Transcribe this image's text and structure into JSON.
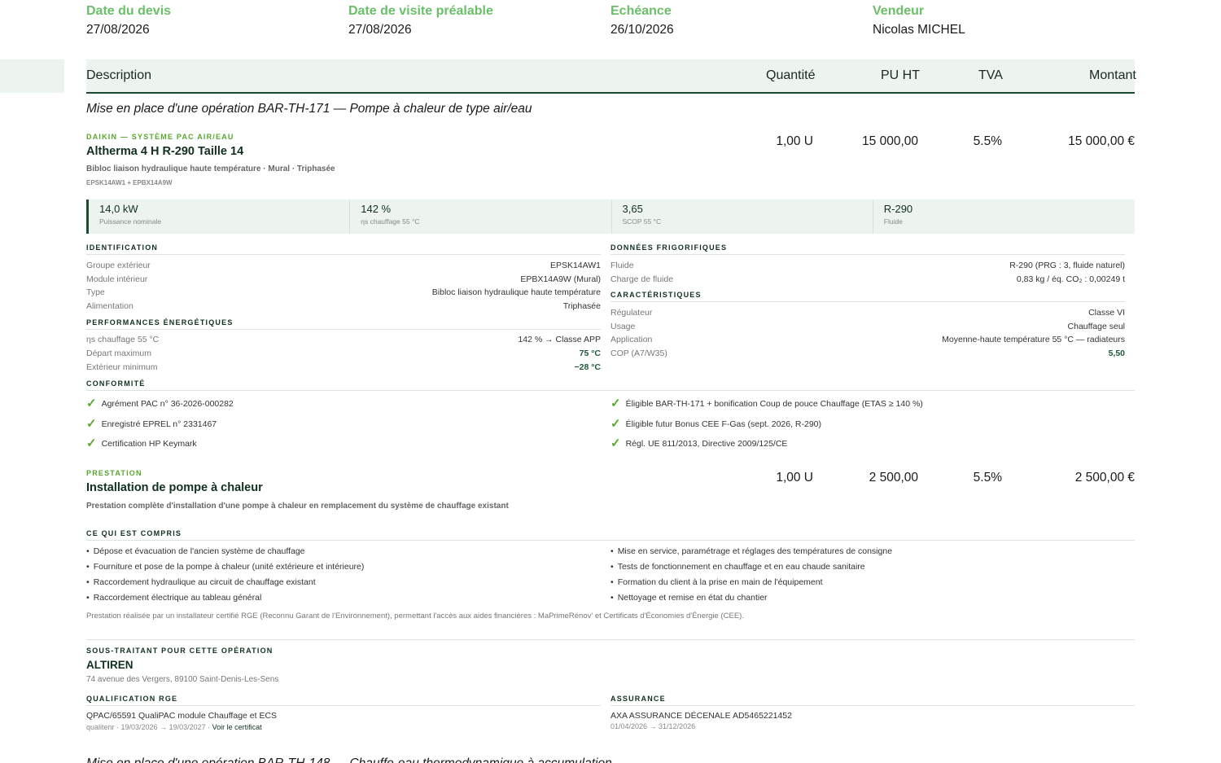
{
  "meta": [
    {
      "label": "Date du devis",
      "value": "27/08/2026"
    },
    {
      "label": "Date de visite préalable",
      "value": "27/08/2026"
    },
    {
      "label": "Echéance",
      "value": "26/10/2026"
    },
    {
      "label": "Vendeur",
      "value": "Nicolas MICHEL"
    }
  ],
  "table_header": {
    "description": "Description",
    "quantity": "Quantité",
    "pu_ht": "PU HT",
    "tva": "TVA",
    "montant": "Montant"
  },
  "section_title": "Mise en place d'une opération BAR-TH-171 — Pompe à chaleur de type air/eau",
  "product": {
    "brand_tag": "DAIKIN — SYSTÈME PAC AIR/EAU",
    "title": "Altherma 4 H R-290 Taille 14",
    "subtitle": "Bibloc liaison hydraulique haute température · Mural · Triphasée",
    "ref": "EPSK14AW1 + EPBX14A9W",
    "quantity": "1,00 U",
    "pu_ht": "15 000,00",
    "tva": "5.5%",
    "montant": "15 000,00 €",
    "specs": [
      {
        "value": "14,0 kW",
        "label": "Puissance nominale"
      },
      {
        "value": "142 %",
        "label": "ηs chauffage 55 °C"
      },
      {
        "value": "3,65",
        "label": "SCOP 55 °C"
      },
      {
        "value": "R-290",
        "label": "Fluide"
      }
    ],
    "identification": {
      "heading": "IDENTIFICATION",
      "rows": [
        {
          "k": "Groupe extérieur",
          "v": "EPSK14AW1"
        },
        {
          "k": "Module intérieur",
          "v": "EPBX14A9W (Mural)"
        },
        {
          "k": "Type",
          "v": "Bibloc liaison hydraulique haute température"
        },
        {
          "k": "Alimentation",
          "v": "Triphasée"
        }
      ]
    },
    "performances": {
      "heading": "PERFORMANCES ÉNERGÉTIQUES",
      "rows": [
        {
          "k": "ηs chauffage 55 °C",
          "v": "142 % → Classe APP"
        },
        {
          "k": "Départ maximum",
          "v": "75 °C"
        },
        {
          "k": "Extérieur minimum",
          "v": "−28 °C"
        }
      ]
    },
    "frigorifiques": {
      "heading": "DONNÉES FRIGORIFIQUES",
      "rows": [
        {
          "k": "Fluide",
          "v": "R-290 (PRG : 3, fluide naturel)"
        },
        {
          "k": "Charge de fluide",
          "v": "0,83 kg / éq. CO₂ : 0,00249 t"
        }
      ]
    },
    "caracteristiques": {
      "heading": "CARACTÉRISTIQUES",
      "rows": [
        {
          "k": "Régulateur",
          "v": "Classe VI"
        },
        {
          "k": "Usage",
          "v": "Chauffage seul"
        },
        {
          "k": "Application",
          "v": "Moyenne-haute température 55 °C — radiateurs"
        },
        {
          "k": "COP (A7/W35)",
          "v": "5,50"
        }
      ]
    },
    "conformite": {
      "heading": "CONFORMITÉ",
      "left": [
        "Agrément PAC n° 36-2026-000282",
        "Enregistré EPREL n° 2331467",
        "Certification HP Keymark"
      ],
      "right": [
        "Éligible BAR-TH-171 + bonification Coup de pouce Chauffage (ETAS ≥ 140 %)",
        "Éligible futur Bonus CEE F-Gas (sept. 2026, R-290)",
        "Régl. UE 811/2013, Directive 2009/125/CE"
      ]
    }
  },
  "prestation": {
    "tag": "PRESTATION",
    "title": "Installation de pompe à chaleur",
    "subtitle": "Prestation complète d'installation d'une pompe à chaleur en remplacement du système de chauffage existant",
    "quantity": "1,00 U",
    "pu_ht": "2 500,00",
    "tva": "5.5%",
    "montant": "2 500,00 €",
    "included_heading": "CE QUI EST COMPRIS",
    "left": [
      "Dépose et évacuation de l'ancien système de chauffage",
      "Fourniture et pose de la pompe à chaleur (unité extérieure et intérieure)",
      "Raccordement hydraulique au circuit de chauffage existant",
      "Raccordement électrique au tableau général"
    ],
    "right": [
      "Mise en service, paramétrage et réglages des températures de consigne",
      "Tests de fonctionnement en chauffage et en eau chaude sanitaire",
      "Formation du client à la prise en main de l'équipement",
      "Nettoyage et remise en état du chantier"
    ],
    "note": "Prestation réalisée par un installateur certifié RGE (Reconnu Garant de l'Environnement), permettant l'accès aux aides financières : MaPrimeRénov' et Certificats d'Économies d'Énergie (CEE)."
  },
  "subcontractor": {
    "heading": "SOUS-TRAITANT POUR CETTE OPÉRATION",
    "name": "ALTIREN",
    "address": "74 avenue des Vergers, 89100 Saint-Denis-Les-Sens",
    "rge_heading": "QUALIFICATION RGE",
    "rge_value": "QPAC/65591 QualiPAC module Chauffage et ECS",
    "rge_dates": "qualitenr · 19/03/2026 → 19/03/2027 ·",
    "rge_link": "Voir le certificat",
    "insurance_heading": "ASSURANCE",
    "insurance_value": "AXA ASSURANCE DÉCENALE AD5465221452",
    "insurance_dates": "01/04/2026 → 31/12/2026"
  },
  "next_section_title": "Mise en place d'une opération BAR-TH-148 — Chauffe-eau thermodynamique à accumulation"
}
